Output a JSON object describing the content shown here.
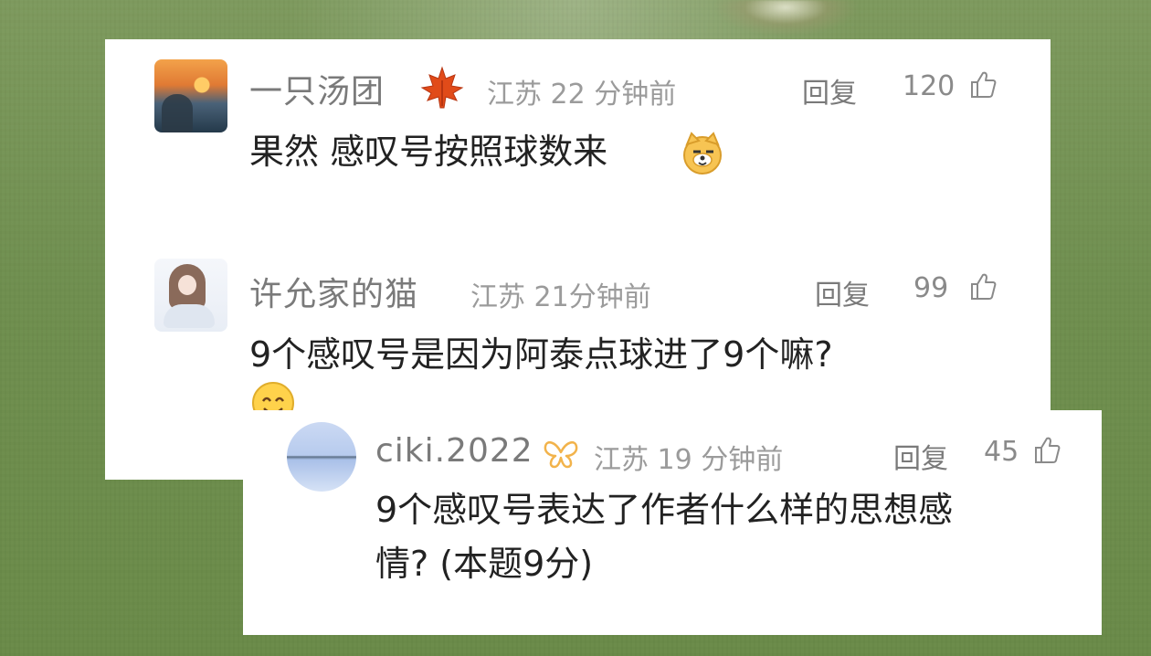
{
  "comments": [
    {
      "username": "一只汤团",
      "badge_icon": "maple-leaf-icon",
      "location": "江苏",
      "time": "22 分钟前",
      "reply_label": "回复",
      "likes": "120",
      "text": "果然 感叹号按照球数来",
      "trailing_emoji": "dog-face-emoji"
    },
    {
      "username": "许允家的猫",
      "location": "江苏",
      "time": "21分钟前",
      "reply_label": "回复",
      "likes": "99",
      "text": "9个感叹号是因为阿泰点球进了9个嘛?",
      "trailing_emoji": "smile-emoji"
    }
  ],
  "reply": {
    "username": "ciki.2022",
    "badge_icon": "butterfly-icon",
    "location": "江苏",
    "time": "19 分钟前",
    "reply_label": "回复",
    "likes": "45",
    "text_line1": "9个感叹号表达了作者什么样的思想感",
    "text_line2": "情?  (本题9分)"
  },
  "colors": {
    "background": "#6f8f4f",
    "card": "#ffffff",
    "username": "#7a7a7a",
    "meta": "#9b9b9b",
    "text": "#222222",
    "maple": "#e14b19",
    "butterfly": "#f2b34b"
  }
}
